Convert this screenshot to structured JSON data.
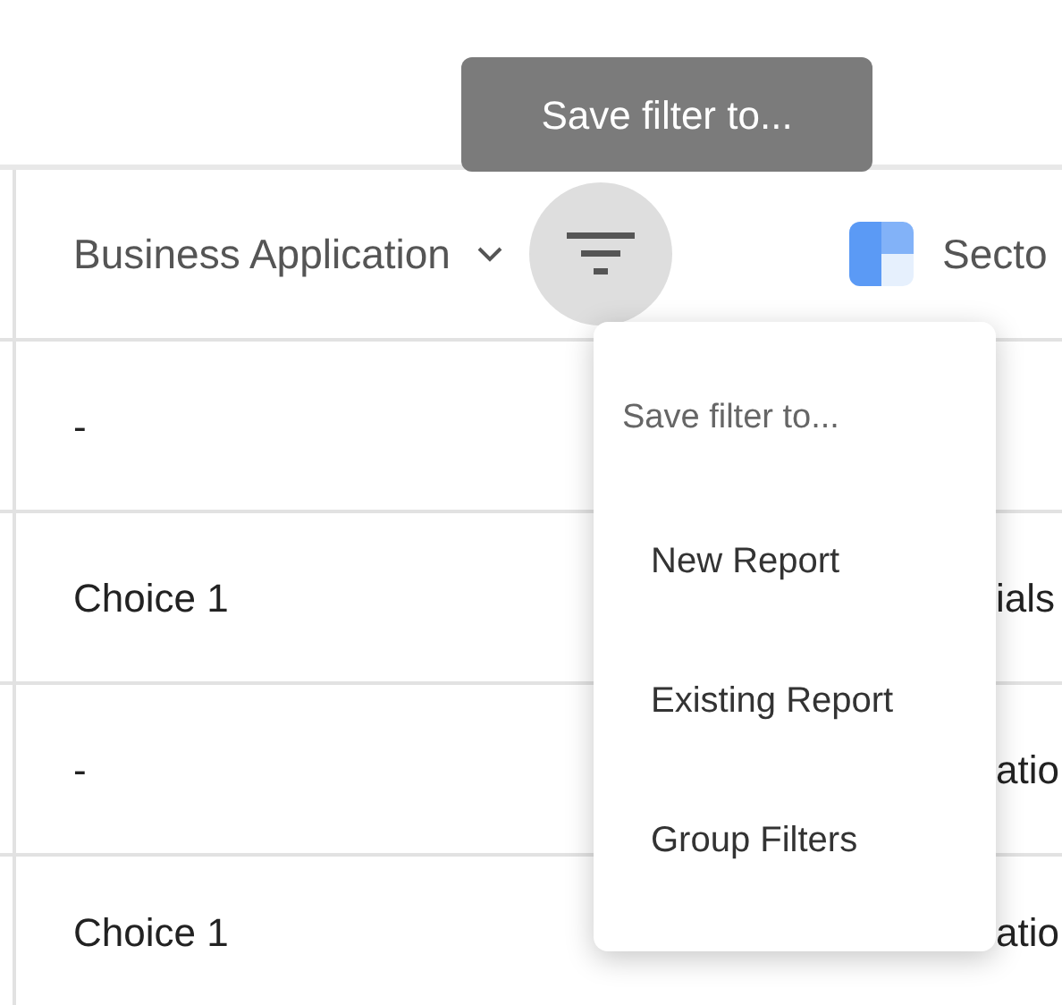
{
  "table": {
    "columns": [
      {
        "label": "Business Application"
      },
      {
        "label": "Secto"
      }
    ],
    "rows": [
      {
        "business_application": "-"
      },
      {
        "business_application": "Choice 1",
        "column_3": "ials"
      },
      {
        "business_application": "-",
        "column_3": "atio"
      },
      {
        "business_application": "Choice 1",
        "column_3": "atio"
      }
    ]
  },
  "filter_button": {
    "hovered": true
  },
  "tooltip": {
    "text": "Save filter to..."
  },
  "menu": {
    "title": "Save filter to...",
    "items": [
      "New Report",
      "Existing Report",
      "Group Filters"
    ]
  }
}
